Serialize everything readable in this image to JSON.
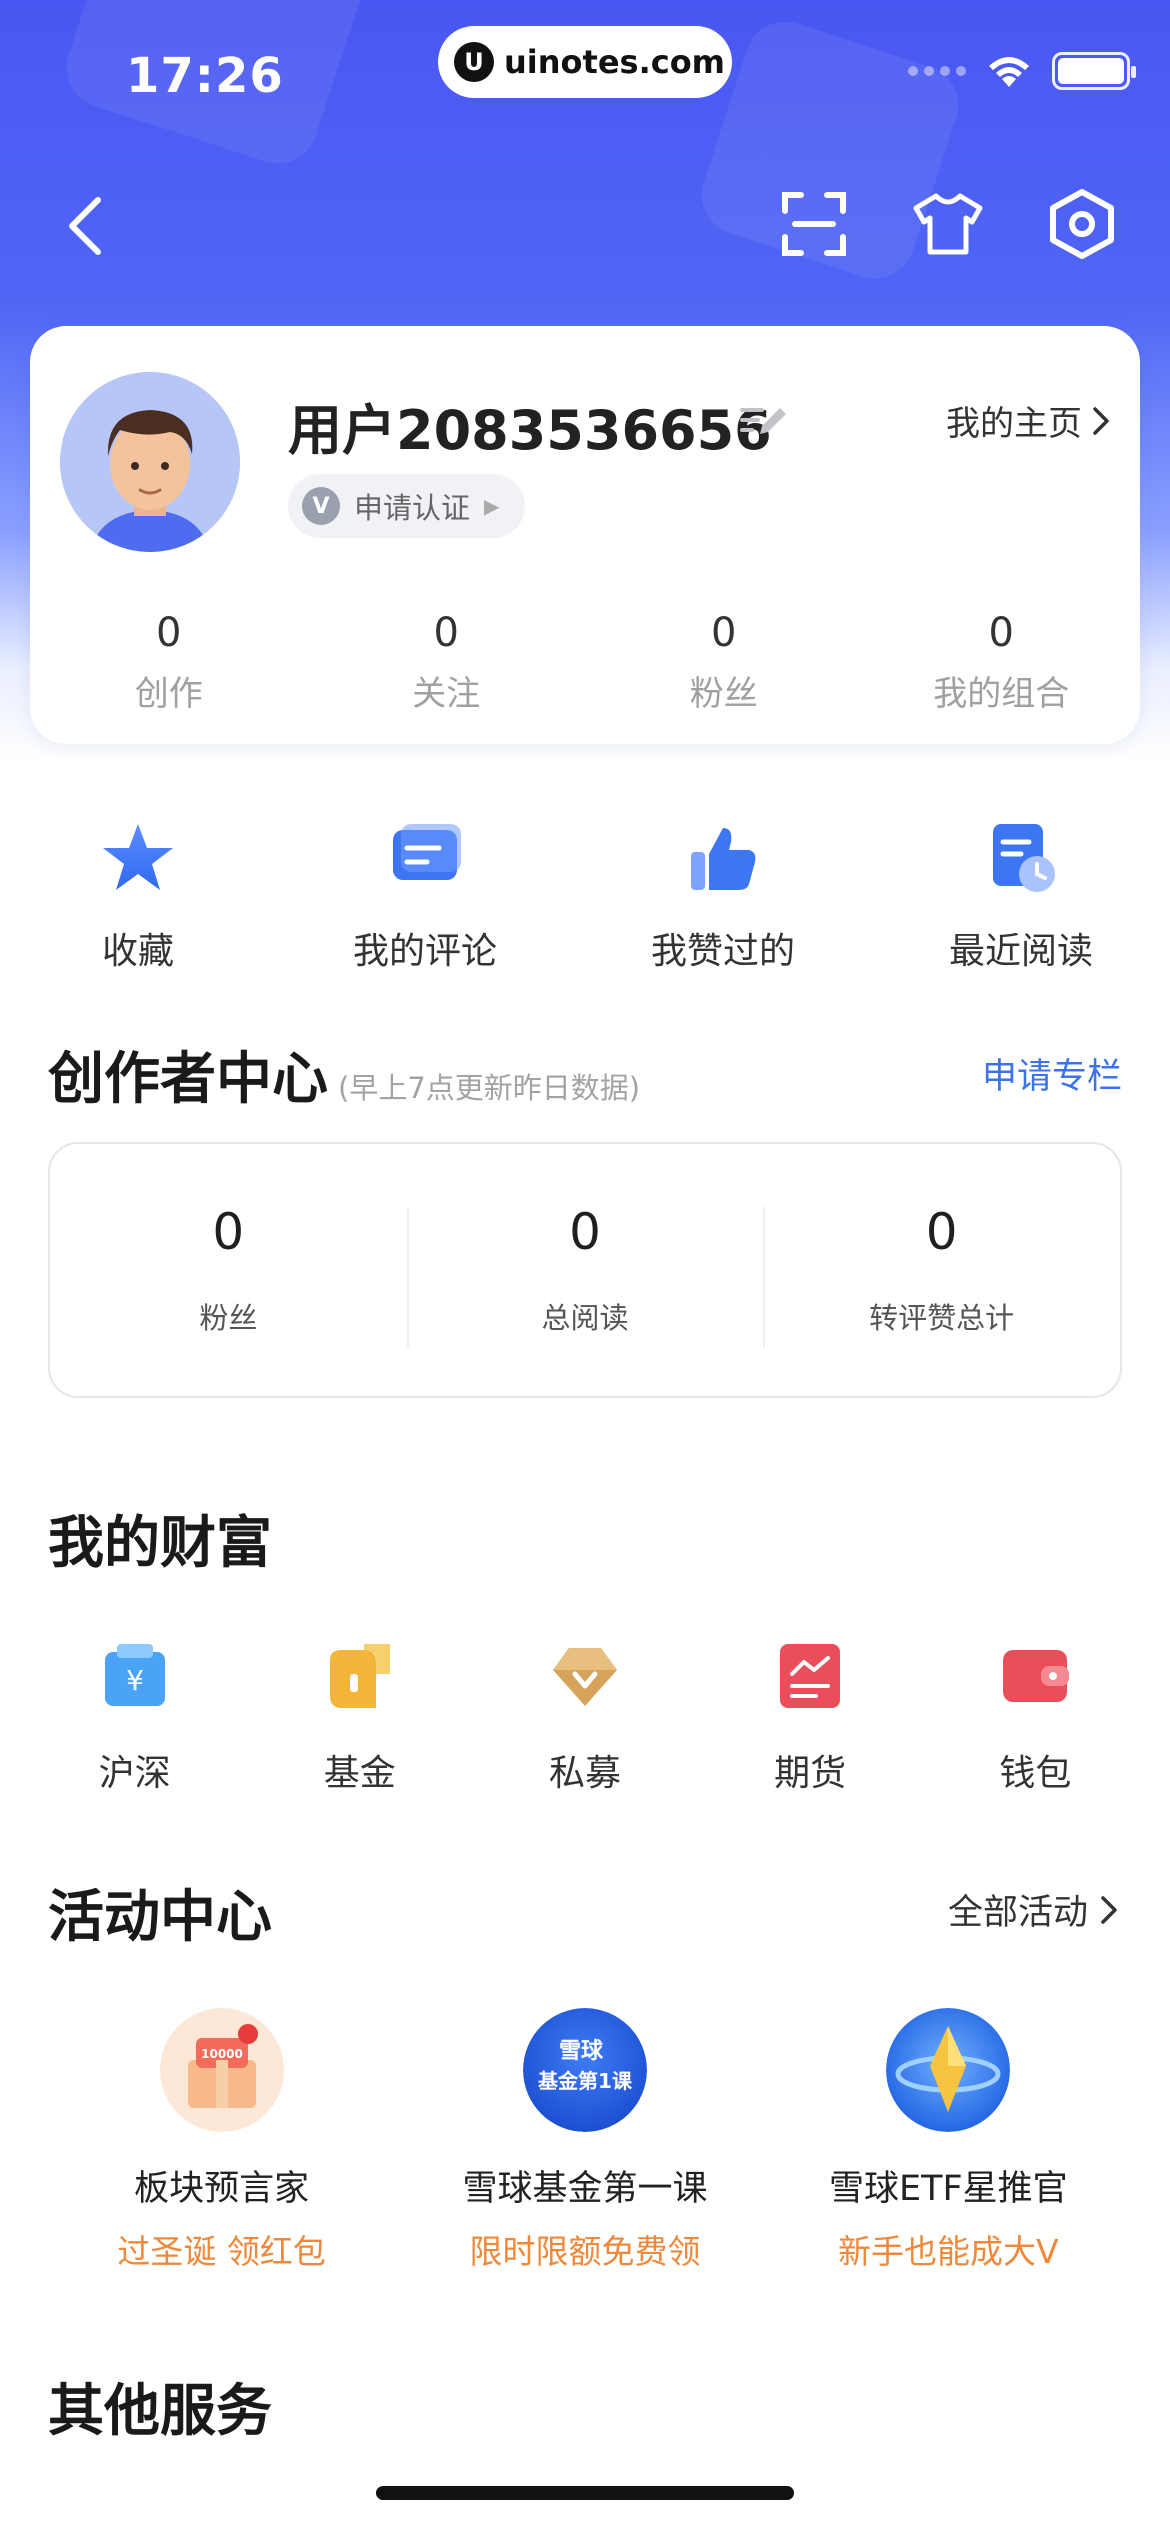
{
  "status_bar": {
    "time": "17:26",
    "url": "uinotes.com",
    "url_logo": "U"
  },
  "profile": {
    "username": "用户2083536656",
    "homepage_link": "我的主页",
    "verify_badge": "V",
    "verify_label": "申请认证",
    "stats": [
      {
        "value": "0",
        "label": "创作"
      },
      {
        "value": "0",
        "label": "关注"
      },
      {
        "value": "0",
        "label": "粉丝"
      },
      {
        "value": "0",
        "label": "我的组合"
      }
    ]
  },
  "quick_actions": [
    {
      "label": "收藏",
      "icon": "star-icon"
    },
    {
      "label": "我的评论",
      "icon": "comment-icon"
    },
    {
      "label": "我赞过的",
      "icon": "thumbs-up-icon"
    },
    {
      "label": "最近阅读",
      "icon": "recent-read-icon"
    }
  ],
  "creator_center": {
    "title": "创作者中心",
    "subtitle": "(早上7点更新昨日数据)",
    "apply_link": "申请专栏",
    "stats": [
      {
        "value": "0",
        "label": "粉丝"
      },
      {
        "value": "0",
        "label": "总阅读"
      },
      {
        "value": "0",
        "label": "转评赞总计"
      }
    ]
  },
  "wealth": {
    "title": "我的财富",
    "items": [
      {
        "label": "沪深",
        "icon": "yuan-bag-icon",
        "glyph": "¥"
      },
      {
        "label": "基金",
        "icon": "fund-icon"
      },
      {
        "label": "私募",
        "icon": "diamond-icon"
      },
      {
        "label": "期货",
        "icon": "futures-chart-icon"
      },
      {
        "label": "钱包",
        "icon": "wallet-icon"
      }
    ]
  },
  "activity": {
    "title": "活动中心",
    "more_link": "全部活动",
    "items": [
      {
        "title": "板块预言家",
        "subtitle": "过圣诞 领红包",
        "image_text": "10000"
      },
      {
        "title": "雪球基金第一课",
        "subtitle": "限时限额免费领",
        "image_line1": "雪球",
        "image_line2": "基金第1课"
      },
      {
        "title": "雪球ETF星推官",
        "subtitle": "新手也能成大V"
      }
    ]
  },
  "other_services": {
    "title": "其他服务"
  },
  "colors": {
    "header_blue": "#4a57f2",
    "link_blue": "#3b74e8",
    "promo_orange": "#f0883a"
  }
}
